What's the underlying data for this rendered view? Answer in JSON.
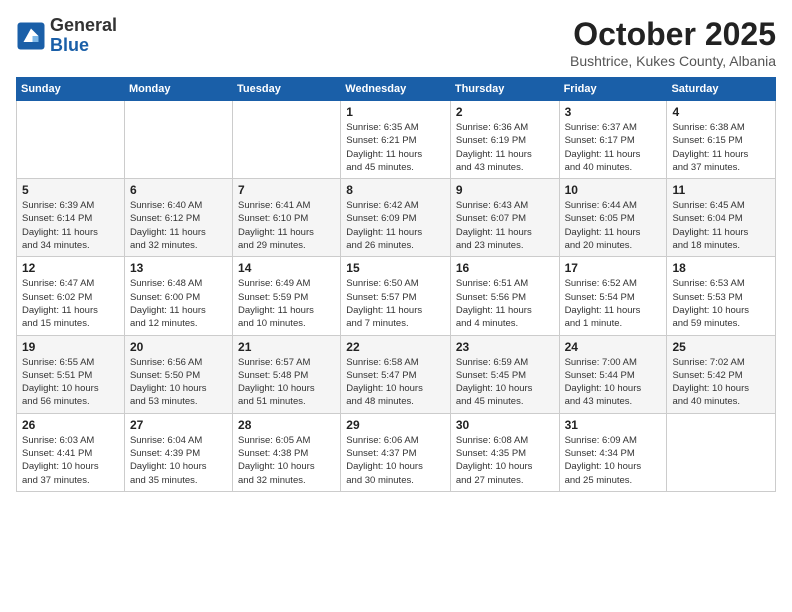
{
  "logo": {
    "general": "General",
    "blue": "Blue"
  },
  "title": "October 2025",
  "subtitle": "Bushtrice, Kukes County, Albania",
  "days_of_week": [
    "Sunday",
    "Monday",
    "Tuesday",
    "Wednesday",
    "Thursday",
    "Friday",
    "Saturday"
  ],
  "weeks": [
    [
      {
        "day": "",
        "info": ""
      },
      {
        "day": "",
        "info": ""
      },
      {
        "day": "",
        "info": ""
      },
      {
        "day": "1",
        "info": "Sunrise: 6:35 AM\nSunset: 6:21 PM\nDaylight: 11 hours\nand 45 minutes."
      },
      {
        "day": "2",
        "info": "Sunrise: 6:36 AM\nSunset: 6:19 PM\nDaylight: 11 hours\nand 43 minutes."
      },
      {
        "day": "3",
        "info": "Sunrise: 6:37 AM\nSunset: 6:17 PM\nDaylight: 11 hours\nand 40 minutes."
      },
      {
        "day": "4",
        "info": "Sunrise: 6:38 AM\nSunset: 6:15 PM\nDaylight: 11 hours\nand 37 minutes."
      }
    ],
    [
      {
        "day": "5",
        "info": "Sunrise: 6:39 AM\nSunset: 6:14 PM\nDaylight: 11 hours\nand 34 minutes."
      },
      {
        "day": "6",
        "info": "Sunrise: 6:40 AM\nSunset: 6:12 PM\nDaylight: 11 hours\nand 32 minutes."
      },
      {
        "day": "7",
        "info": "Sunrise: 6:41 AM\nSunset: 6:10 PM\nDaylight: 11 hours\nand 29 minutes."
      },
      {
        "day": "8",
        "info": "Sunrise: 6:42 AM\nSunset: 6:09 PM\nDaylight: 11 hours\nand 26 minutes."
      },
      {
        "day": "9",
        "info": "Sunrise: 6:43 AM\nSunset: 6:07 PM\nDaylight: 11 hours\nand 23 minutes."
      },
      {
        "day": "10",
        "info": "Sunrise: 6:44 AM\nSunset: 6:05 PM\nDaylight: 11 hours\nand 20 minutes."
      },
      {
        "day": "11",
        "info": "Sunrise: 6:45 AM\nSunset: 6:04 PM\nDaylight: 11 hours\nand 18 minutes."
      }
    ],
    [
      {
        "day": "12",
        "info": "Sunrise: 6:47 AM\nSunset: 6:02 PM\nDaylight: 11 hours\nand 15 minutes."
      },
      {
        "day": "13",
        "info": "Sunrise: 6:48 AM\nSunset: 6:00 PM\nDaylight: 11 hours\nand 12 minutes."
      },
      {
        "day": "14",
        "info": "Sunrise: 6:49 AM\nSunset: 5:59 PM\nDaylight: 11 hours\nand 10 minutes."
      },
      {
        "day": "15",
        "info": "Sunrise: 6:50 AM\nSunset: 5:57 PM\nDaylight: 11 hours\nand 7 minutes."
      },
      {
        "day": "16",
        "info": "Sunrise: 6:51 AM\nSunset: 5:56 PM\nDaylight: 11 hours\nand 4 minutes."
      },
      {
        "day": "17",
        "info": "Sunrise: 6:52 AM\nSunset: 5:54 PM\nDaylight: 11 hours\nand 1 minute."
      },
      {
        "day": "18",
        "info": "Sunrise: 6:53 AM\nSunset: 5:53 PM\nDaylight: 10 hours\nand 59 minutes."
      }
    ],
    [
      {
        "day": "19",
        "info": "Sunrise: 6:55 AM\nSunset: 5:51 PM\nDaylight: 10 hours\nand 56 minutes."
      },
      {
        "day": "20",
        "info": "Sunrise: 6:56 AM\nSunset: 5:50 PM\nDaylight: 10 hours\nand 53 minutes."
      },
      {
        "day": "21",
        "info": "Sunrise: 6:57 AM\nSunset: 5:48 PM\nDaylight: 10 hours\nand 51 minutes."
      },
      {
        "day": "22",
        "info": "Sunrise: 6:58 AM\nSunset: 5:47 PM\nDaylight: 10 hours\nand 48 minutes."
      },
      {
        "day": "23",
        "info": "Sunrise: 6:59 AM\nSunset: 5:45 PM\nDaylight: 10 hours\nand 45 minutes."
      },
      {
        "day": "24",
        "info": "Sunrise: 7:00 AM\nSunset: 5:44 PM\nDaylight: 10 hours\nand 43 minutes."
      },
      {
        "day": "25",
        "info": "Sunrise: 7:02 AM\nSunset: 5:42 PM\nDaylight: 10 hours\nand 40 minutes."
      }
    ],
    [
      {
        "day": "26",
        "info": "Sunrise: 6:03 AM\nSunset: 4:41 PM\nDaylight: 10 hours\nand 37 minutes."
      },
      {
        "day": "27",
        "info": "Sunrise: 6:04 AM\nSunset: 4:39 PM\nDaylight: 10 hours\nand 35 minutes."
      },
      {
        "day": "28",
        "info": "Sunrise: 6:05 AM\nSunset: 4:38 PM\nDaylight: 10 hours\nand 32 minutes."
      },
      {
        "day": "29",
        "info": "Sunrise: 6:06 AM\nSunset: 4:37 PM\nDaylight: 10 hours\nand 30 minutes."
      },
      {
        "day": "30",
        "info": "Sunrise: 6:08 AM\nSunset: 4:35 PM\nDaylight: 10 hours\nand 27 minutes."
      },
      {
        "day": "31",
        "info": "Sunrise: 6:09 AM\nSunset: 4:34 PM\nDaylight: 10 hours\nand 25 minutes."
      },
      {
        "day": "",
        "info": ""
      }
    ]
  ]
}
